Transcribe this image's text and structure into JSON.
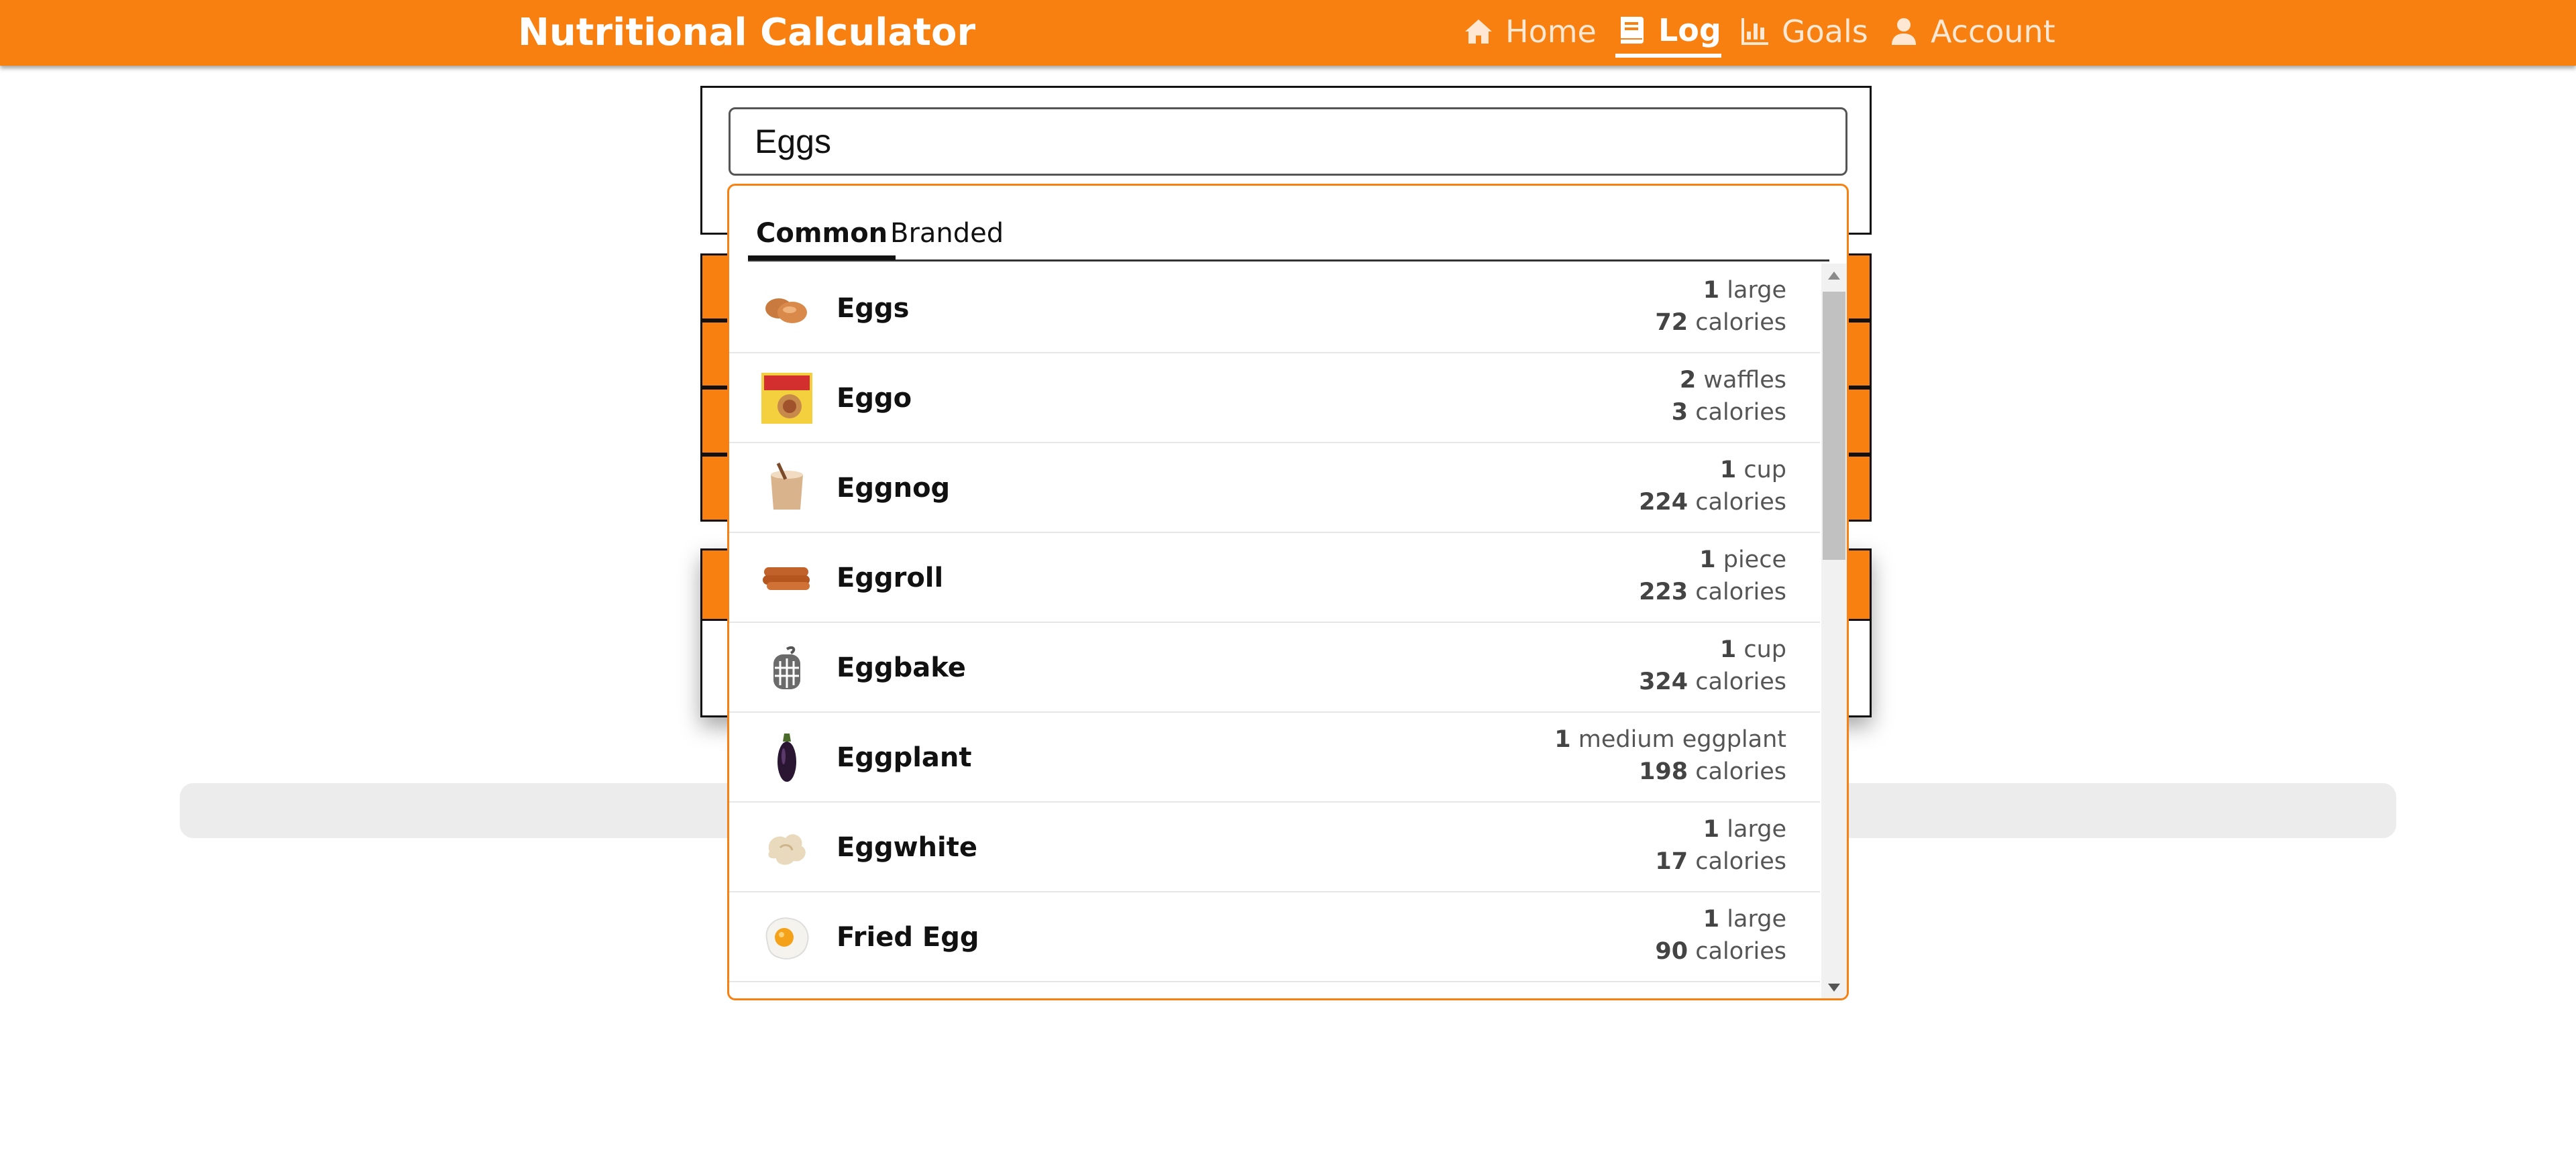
{
  "app": {
    "brand": "Nutritional Calculator"
  },
  "nav": {
    "home": "Home",
    "log": "Log",
    "goals": "Goals",
    "account": "Account",
    "active": "log"
  },
  "search": {
    "value": "Eggs"
  },
  "dropdown": {
    "tabs": {
      "common": "Common",
      "branded": "Branded",
      "active": "common"
    },
    "items": [
      {
        "name": "Eggs",
        "serving_qty": "1",
        "serving_unit": "large",
        "calories": "72",
        "calories_label": "calories",
        "icon": "eggs-thumbnail"
      },
      {
        "name": "Eggo",
        "serving_qty": "2",
        "serving_unit": "waffles",
        "calories": "3",
        "calories_label": "calories",
        "icon": "eggo-box-thumbnail"
      },
      {
        "name": "Eggnog",
        "serving_qty": "1",
        "serving_unit": "cup",
        "calories": "224",
        "calories_label": "calories",
        "icon": "eggnog-thumbnail"
      },
      {
        "name": "Eggroll",
        "serving_qty": "1",
        "serving_unit": "piece",
        "calories": "223",
        "calories_label": "calories",
        "icon": "eggroll-thumbnail"
      },
      {
        "name": "Eggbake",
        "serving_qty": "1",
        "serving_unit": "cup",
        "calories": "324",
        "calories_label": "calories",
        "icon": "placeholder-food-icon"
      },
      {
        "name": "Eggplant",
        "serving_qty": "1",
        "serving_unit": "medium eggplant",
        "calories": "198",
        "calories_label": "calories",
        "icon": "eggplant-thumbnail"
      },
      {
        "name": "Eggwhite",
        "serving_qty": "1",
        "serving_unit": "large",
        "calories": "17",
        "calories_label": "calories",
        "icon": "eggwhite-thumbnail"
      },
      {
        "name": "Fried Egg",
        "serving_qty": "1",
        "serving_unit": "large",
        "calories": "90",
        "calories_label": "calories",
        "icon": "fried-egg-thumbnail"
      }
    ]
  },
  "colors": {
    "accent": "#f88011",
    "text": "#111111",
    "muted": "#555555"
  }
}
